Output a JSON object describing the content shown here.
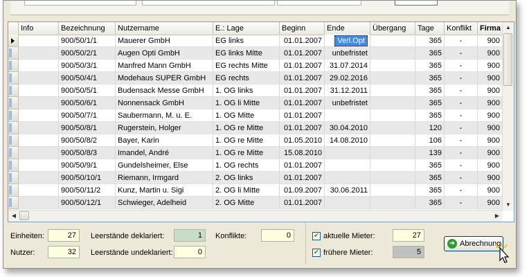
{
  "grid": {
    "columns": [
      "Info",
      "Bezeichnung",
      "Nutzername",
      "E.: Lage",
      "Beginn",
      "Ende",
      "Übergang",
      "Tage",
      "Konflikt",
      "Firma"
    ],
    "rows": [
      [
        "",
        "900/50/1/1",
        "Mauerer GmbH",
        "EG links",
        "01.01.2007",
        "Verl.Opt",
        "",
        "365",
        "-",
        "900"
      ],
      [
        "",
        "900/50/2/1",
        "Augen Opti GmbH",
        "EG links Mitte",
        "01.01.2007",
        "unbefristet",
        "",
        "365",
        "-",
        "900"
      ],
      [
        "",
        "900/50/3/1",
        "Manfred Mann GmbH",
        "EG rechts Mitte",
        "01.01.2007",
        "31.07.2014",
        "",
        "365",
        "-",
        "900"
      ],
      [
        "",
        "900/50/4/1",
        "Modehaus SUPER GmbH",
        "EG rechts",
        "01.01.2007",
        "29.02.2016",
        "",
        "365",
        "-",
        "900"
      ],
      [
        "",
        "900/50/5/1",
        "Budensack Messe GmbH",
        "1. OG links",
        "01.01.2007",
        "31.12.2011",
        "",
        "365",
        "-",
        "900"
      ],
      [
        "",
        "900/50/6/1",
        "Nonnensack GmbH",
        "1. OG li Mitte",
        "01.01.2007",
        "unbefristet",
        "",
        "365",
        "-",
        "900"
      ],
      [
        "",
        "900/50/7/1",
        "Saubermann, M. u. E.",
        "1. OG Mitte",
        "01.01.2007",
        "",
        "",
        "365",
        "-",
        "900"
      ],
      [
        "",
        "900/50/8/1",
        "Rugerstein, Holger",
        "1. OG re Mitte",
        "01.01.2007",
        "30.04.2010",
        "",
        "120",
        "-",
        "900"
      ],
      [
        "",
        "900/50/8/2",
        "Bayer, Karin",
        "1. OG re Mitte",
        "01.05.2010",
        "14.08.2010",
        "",
        "106",
        "-",
        "900"
      ],
      [
        "",
        "900/50/8/3",
        "Imandel, André",
        "1. OG re Mitte",
        "15.08.2010",
        "",
        "",
        "139",
        "-",
        "900"
      ],
      [
        "",
        "900/50/9/1",
        "Gundelsheimer, Else",
        "1. OG rechts",
        "01.01.2007",
        "",
        "",
        "365",
        "-",
        "900"
      ],
      [
        "",
        "900/50/10/1",
        "Riemann, Irmgard",
        "2. OG links",
        "01.01.2007",
        "",
        "",
        "365",
        "-",
        "900"
      ],
      [
        "",
        "900/50/11/2",
        "Kunz, Martin u. Sigi",
        "2. OG li Mitte",
        "01.09.2007",
        "30.06.2011",
        "",
        "365",
        "-",
        "900"
      ],
      [
        "",
        "900/50/12/1",
        "Schwieger, Adelheid",
        "2. OG Mitte",
        "01.01.2007",
        "",
        "",
        "365",
        "-",
        "900"
      ]
    ]
  },
  "summary": {
    "einheiten_label": "Einheiten:",
    "einheiten_value": "27",
    "nutzer_label": "Nutzer:",
    "nutzer_value": "32",
    "leer_dekl_label": "Leerstände deklariert:",
    "leer_dekl_value": "1",
    "leer_undekl_label": "Leerstände undeklariert:",
    "leer_undekl_value": "0",
    "konflikte_label": "Konflikte:",
    "konflikte_value": "0",
    "aktuelle_label": "aktuelle Mieter:",
    "aktuelle_value": "27",
    "fruehere_label": "frühere Mieter:",
    "fruehere_value": "5"
  },
  "button": {
    "label": "Abrechnung"
  },
  "colors": {
    "selection": "#3d8ee6",
    "yellow_field": "#ffffe1",
    "green_field": "#c8dcc8"
  }
}
